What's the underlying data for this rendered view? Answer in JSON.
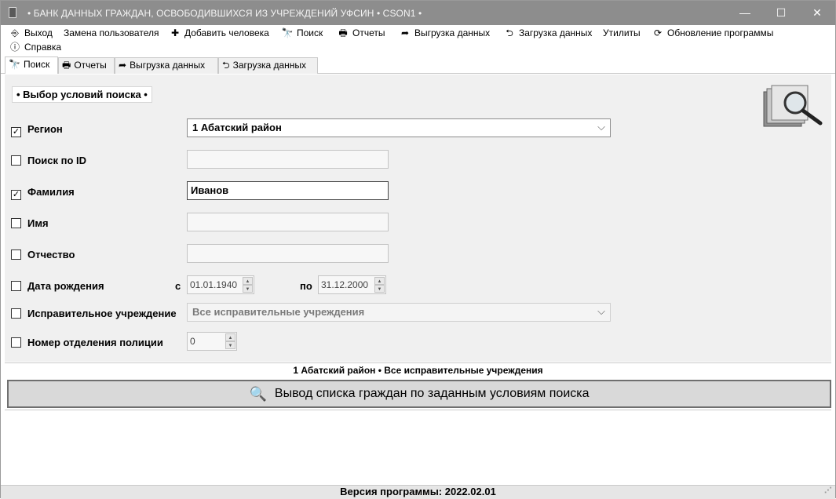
{
  "window": {
    "title": "• БАНК ДАННЫХ ГРАЖДАН, ОСВОБОДИВШИХСЯ ИЗ УЧРЕЖДЕНИЙ УФСИН • CSON1 •",
    "minimize": "—",
    "maximize": "☐",
    "close": "✕"
  },
  "menu": {
    "exit": "Выход",
    "change_user": "Замена пользователя",
    "add_person": "Добавить человека",
    "search": "Поиск",
    "reports": "Отчеты",
    "export": "Выгрузка данных",
    "import": "Загрузка данных",
    "utilities": "Утилиты",
    "update": "Обновление программы",
    "help": "Справка"
  },
  "tabs": [
    "Поиск",
    "Отчеты",
    "Выгрузка данных",
    "Загрузка данных"
  ],
  "search": {
    "section_title": "• Выбор условий поиска •",
    "region": {
      "label": "Регион",
      "checked": true,
      "value": "1   Абатский район"
    },
    "id": {
      "label": "Поиск по ID",
      "checked": false,
      "value": ""
    },
    "surname": {
      "label": "Фамилия",
      "checked": true,
      "value": "Иванов"
    },
    "name": {
      "label": "Имя",
      "checked": false,
      "value": ""
    },
    "patronymic": {
      "label": "Отчество",
      "checked": false,
      "value": ""
    },
    "birth": {
      "label": "Дата рождения",
      "checked": false,
      "from_label": "с",
      "from": "01.01.1940",
      "to_label": "по",
      "to": "31.12.2000"
    },
    "institution": {
      "label": "Исправительное учреждение",
      "checked": false,
      "value": "Все исправительные учреждения"
    },
    "police": {
      "label": "Номер отделения полиции",
      "checked": false,
      "value": "0"
    }
  },
  "summary": "1   Абатский район • Все исправительные учреждения",
  "action_button": "Вывод списка граждан по заданным условиям поиска",
  "footer": "Версия программы: 2022.02.01"
}
